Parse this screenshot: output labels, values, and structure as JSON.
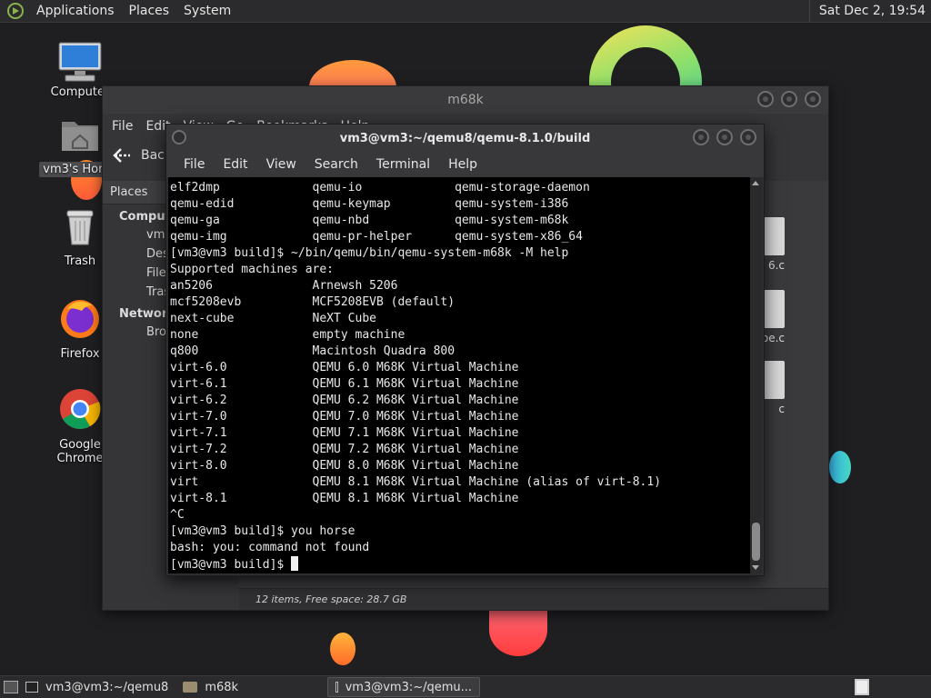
{
  "top_panel": {
    "menus": [
      "Applications",
      "Places",
      "System"
    ],
    "clock": "Sat Dec 2, 19:54"
  },
  "desktop_icons": [
    {
      "label": "Computer",
      "icon": "monitor-icon"
    },
    {
      "label": "vm3's Home",
      "icon": "home-folder-icon"
    },
    {
      "label": "Trash",
      "icon": "trash-icon"
    },
    {
      "label": "Firefox",
      "icon": "firefox-icon"
    },
    {
      "label": "Google Chrome",
      "icon": "chrome-icon"
    }
  ],
  "file_manager": {
    "title": "m68k",
    "menus": [
      "File",
      "Edit",
      "View",
      "Go",
      "Bookmarks",
      "Help"
    ],
    "back_label": "Back",
    "sidebar": {
      "header": "Places",
      "sections": [
        {
          "title": "Computer",
          "items": [
            "vm3",
            "Desktop",
            "File System",
            "Trash"
          ]
        },
        {
          "title": "Network",
          "items": [
            "Browse Network"
          ]
        }
      ]
    },
    "files": [
      "6.c",
      "be.c",
      "c"
    ],
    "status": "12 items, Free space: 28.7 GB"
  },
  "terminal": {
    "title": "vm3@vm3:~/qemu8/qemu-8.1.0/build",
    "menus": [
      "File",
      "Edit",
      "View",
      "Search",
      "Terminal",
      "Help"
    ],
    "lines": [
      "elf2dmp             qemu-io             qemu-storage-daemon",
      "qemu-edid           qemu-keymap         qemu-system-i386",
      "qemu-ga             qemu-nbd            qemu-system-m68k",
      "qemu-img            qemu-pr-helper      qemu-system-x86_64",
      "[vm3@vm3 build]$ ~/bin/qemu/bin/qemu-system-m68k -M help",
      "Supported machines are:",
      "an5206              Arnewsh 5206",
      "mcf5208evb          MCF5208EVB (default)",
      "next-cube           NeXT Cube",
      "none                empty machine",
      "q800                Macintosh Quadra 800",
      "virt-6.0            QEMU 6.0 M68K Virtual Machine",
      "virt-6.1            QEMU 6.1 M68K Virtual Machine",
      "virt-6.2            QEMU 6.2 M68K Virtual Machine",
      "virt-7.0            QEMU 7.0 M68K Virtual Machine",
      "virt-7.1            QEMU 7.1 M68K Virtual Machine",
      "virt-7.2            QEMU 7.2 M68K Virtual Machine",
      "virt-8.0            QEMU 8.0 M68K Virtual Machine",
      "virt                QEMU 8.1 M68K Virtual Machine (alias of virt-8.1)",
      "virt-8.1            QEMU 8.1 M68K Virtual Machine",
      "^C",
      "[vm3@vm3 build]$ you horse",
      "bash: you: command not found"
    ],
    "prompt": "[vm3@vm3 build]$ "
  },
  "taskbar": {
    "items": [
      {
        "label": "vm3@vm3:~/qemu8",
        "icon": "terminal-icon",
        "active": false
      },
      {
        "label": "m68k",
        "icon": "folder-icon",
        "active": false
      },
      {
        "label": "vm3@vm3:~/qemu...",
        "icon": "terminal-icon",
        "active": true
      }
    ]
  },
  "colors": {
    "panel": "#2b2b2d",
    "terminal_bg": "#000000",
    "terminal_fg": "#e8e8e8",
    "window_chrome": "#38383b"
  }
}
